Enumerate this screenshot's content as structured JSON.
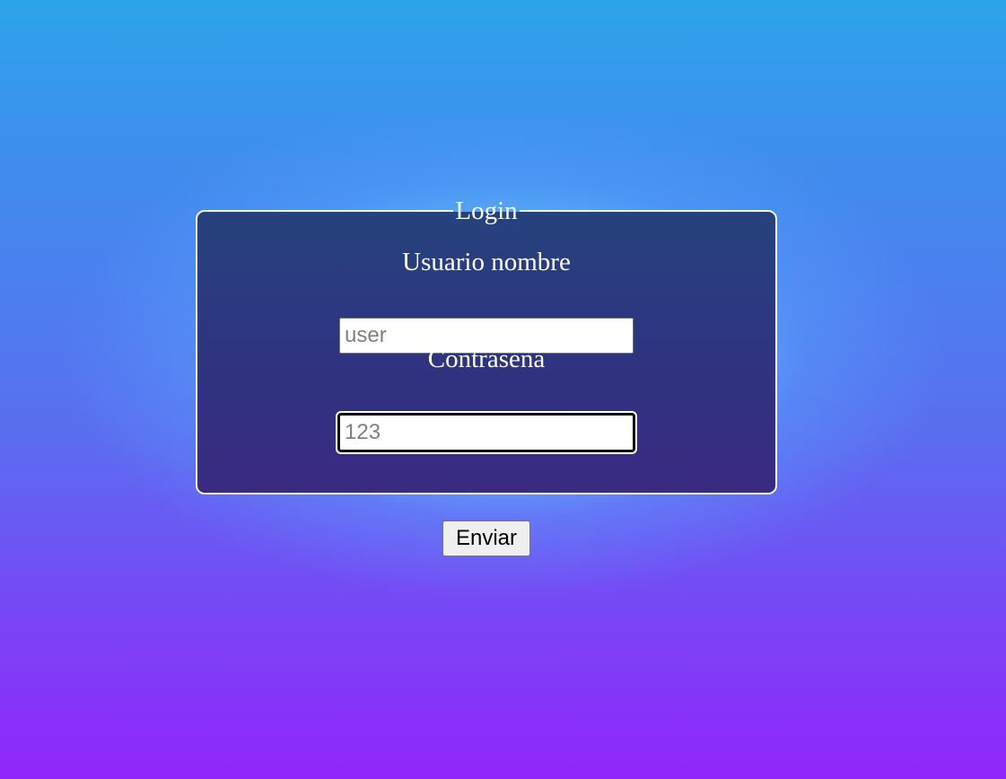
{
  "login_form": {
    "legend": "Login",
    "username_label": "Usuario nombre",
    "username_placeholder": "user",
    "username_value": "",
    "password_label": "Contraseña",
    "password_placeholder": "123",
    "password_value": "",
    "submit_label": "Enviar"
  },
  "colors": {
    "background_top": "#2ca4ea",
    "background_bottom": "#9026fb",
    "panel_top": "#26437e",
    "panel_bottom": "#3a2a82",
    "glow": "#6edcff"
  }
}
